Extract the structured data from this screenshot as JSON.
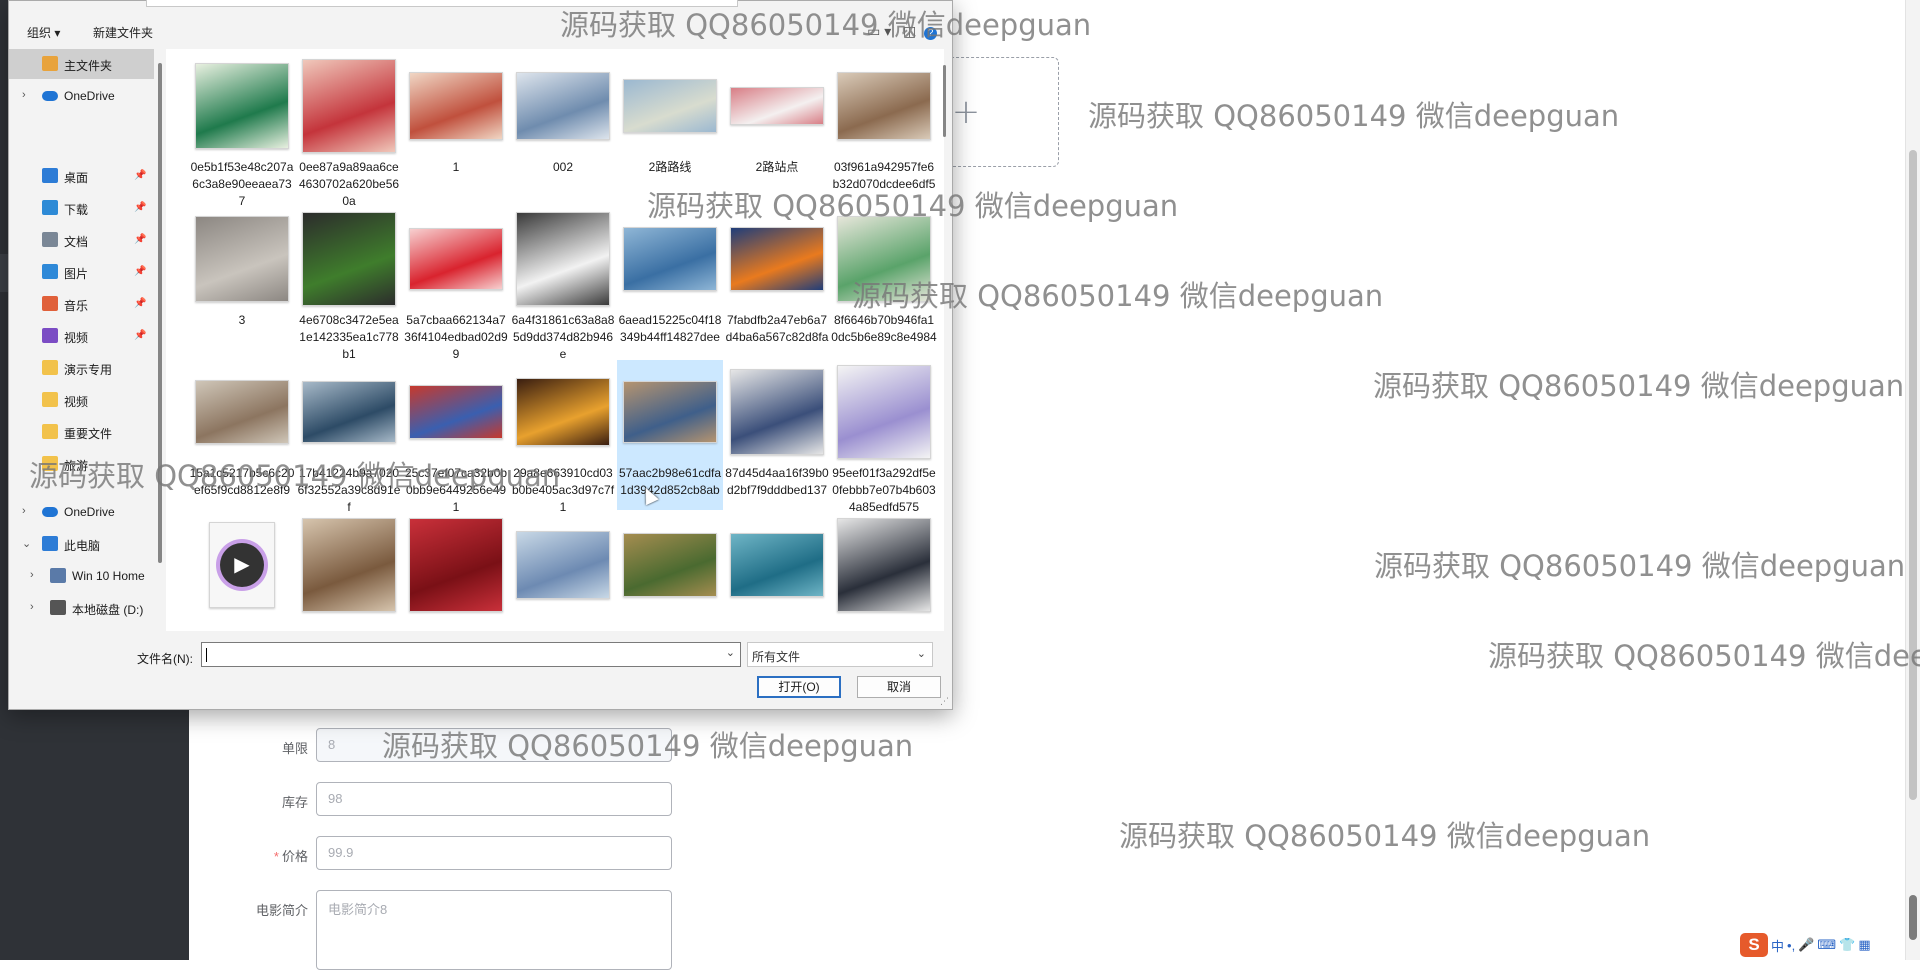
{
  "watermark": "源码获取 QQ86050149 微信deepguan",
  "dialog": {
    "toolbar": {
      "organize": "组织 ▾",
      "new_folder": "新建文件夹"
    },
    "nav": [
      {
        "label": "主文件夹",
        "icon": "home-icon",
        "color": "#e8a33c",
        "selected": true,
        "chevron": false,
        "pin": false
      },
      {
        "label": "OneDrive",
        "icon": "cloud-icon",
        "color": "#1f74d4",
        "selected": false,
        "chevron": true,
        "pin": false
      },
      {
        "label": "桌面",
        "icon": "desktop-icon",
        "color": "#2d7cd6",
        "selected": false,
        "chevron": false,
        "pin": true
      },
      {
        "label": "下载",
        "icon": "download-icon",
        "color": "#2d8ad6",
        "selected": false,
        "chevron": false,
        "pin": true
      },
      {
        "label": "文档",
        "icon": "document-icon",
        "color": "#7a8796",
        "selected": false,
        "chevron": false,
        "pin": true
      },
      {
        "label": "图片",
        "icon": "picture-icon",
        "color": "#2e89d8",
        "selected": false,
        "chevron": false,
        "pin": true
      },
      {
        "label": "音乐",
        "icon": "music-icon",
        "color": "#e0603a",
        "selected": false,
        "chevron": false,
        "pin": true
      },
      {
        "label": "视频",
        "icon": "video-icon",
        "color": "#7b4cc4",
        "selected": false,
        "chevron": false,
        "pin": true
      },
      {
        "label": "演示专用",
        "icon": "folder-icon",
        "color": "#f2c24b",
        "selected": false,
        "chevron": false,
        "pin": false
      },
      {
        "label": "视频",
        "icon": "folder-icon",
        "color": "#f2c24b",
        "selected": false,
        "chevron": false,
        "pin": false
      },
      {
        "label": "重要文件",
        "icon": "folder-icon",
        "color": "#f2c24b",
        "selected": false,
        "chevron": false,
        "pin": false
      },
      {
        "label": "旅游",
        "icon": "folder-icon",
        "color": "#f2c24b",
        "selected": false,
        "chevron": false,
        "pin": false
      },
      {
        "label": "OneDrive",
        "icon": "cloud-icon",
        "color": "#1f74d4",
        "selected": false,
        "chevron": true,
        "pin": false
      },
      {
        "label": "此电脑",
        "icon": "computer-icon",
        "color": "#2d7cd6",
        "selected": false,
        "chevron": true,
        "pin": false
      },
      {
        "label": "Win 10 Home",
        "icon": "drive-icon",
        "color": "#5a7aa8",
        "selected": false,
        "chevron": true,
        "pin": false
      },
      {
        "label": "本地磁盘 (D:)",
        "icon": "disk-icon",
        "color": "#555555",
        "selected": false,
        "chevron": true,
        "pin": false
      }
    ],
    "files": [
      {
        "name": "0e5b1f53e48c207a6c3a8e90eeaea737",
        "colors": [
          "#1f7a4c",
          "#e8f0e0"
        ]
      },
      {
        "name": "0ee87a9a89aa6ce4630702a620be560a",
        "colors": [
          "#c4343b",
          "#f0c8bb"
        ]
      },
      {
        "name": "1",
        "colors": [
          "#c0503d",
          "#f0d6c4"
        ]
      },
      {
        "name": "002",
        "colors": [
          "#6f8cae",
          "#dde4ec"
        ]
      },
      {
        "name": "2路路线",
        "colors": [
          "#d8dccf",
          "#9bb8d0"
        ]
      },
      {
        "name": "2路站点",
        "colors": [
          "#f4f0f0",
          "#d87e86"
        ]
      },
      {
        "name": "03f961a942957fe6b32d070dcdee6df5",
        "colors": [
          "#8b6a4f",
          "#d9cab8"
        ]
      },
      {
        "name": "3",
        "colors": [
          "#c9c4bd",
          "#8c8782"
        ]
      },
      {
        "name": "4e6708c3472e5ea1e142335ea1c778b1",
        "colors": [
          "#3f7d2c",
          "#2c2c2c"
        ]
      },
      {
        "name": "5a7cbaa662134a736f4104edbad02d99",
        "colors": [
          "#d9232e",
          "#f7d0d0"
        ]
      },
      {
        "name": "6a4f31861c63a8a85d9dd374d82b946e",
        "colors": [
          "#f2f2f2",
          "#3a3a3a"
        ]
      },
      {
        "name": "6aead15225c04f18349b44ff14827dee",
        "colors": [
          "#3a6fa3",
          "#8fb6d6"
        ]
      },
      {
        "name": "7fabdfb2a47eb6a7d4ba6a567c82d8fa",
        "colors": [
          "#e97a1e",
          "#1f3d7a"
        ]
      },
      {
        "name": "8f6646b70b946fa10dc5b6e89c8e4984",
        "colors": [
          "#5aa36a",
          "#e6e6da"
        ]
      },
      {
        "name": "15a1c5217b5c6c20ef65f9cd8812e8f9",
        "colors": [
          "#8c7560",
          "#cfc6b8"
        ]
      },
      {
        "name": "17b41224b9a70206f32552a39c8d91ef",
        "colors": [
          "#2d4b66",
          "#a7b9c8"
        ]
      },
      {
        "name": "25c37ef07ca32b0b0bb9e6449256e491",
        "colors": [
          "#3a5fb0",
          "#c7392d"
        ]
      },
      {
        "name": "29a8e663910cd03b0be405ac3d97c7f1",
        "colors": [
          "#e8a12e",
          "#3a1e10"
        ]
      },
      {
        "name": "57aac2b98e61cdfa1d3942d852cb8ab",
        "colors": [
          "#3f5f8a",
          "#b59470"
        ]
      },
      {
        "name": "87d45d4aa16f39b0d2bf7f9dddbed137",
        "colors": [
          "#3b4f7a",
          "#e6e6e6"
        ]
      },
      {
        "name": "95eef01f3a292df5e0febbb7e07b4b6034a85edfd575",
        "colors": [
          "#9a8fd0",
          "#f4f4f4"
        ]
      },
      {
        "name": "",
        "colors": [
          "#f8f8f8",
          "#4a4a4a"
        ]
      },
      {
        "name": "",
        "colors": [
          "#7a5a3e",
          "#d6c4ad"
        ]
      },
      {
        "name": "",
        "colors": [
          "#7a1016",
          "#c9303a"
        ]
      },
      {
        "name": "",
        "colors": [
          "#6d8ab2",
          "#c8d8e6"
        ]
      },
      {
        "name": "",
        "colors": [
          "#4a6a30",
          "#a58d50"
        ]
      },
      {
        "name": "",
        "colors": [
          "#1f6d86",
          "#6fb5c6"
        ]
      },
      {
        "name": "",
        "colors": [
          "#2a2f3a",
          "#e6e6e6"
        ]
      }
    ],
    "filename_label": "文件名(N):",
    "filetype": "所有文件",
    "open_button": "打开(O)",
    "cancel_button": "取消"
  },
  "form": {
    "rows": [
      {
        "label": "单限",
        "required": false,
        "value": "8",
        "disabled": true
      },
      {
        "label": "库存",
        "required": false,
        "value": "98",
        "disabled": false
      },
      {
        "label": "价格",
        "required": true,
        "value": "99.9",
        "disabled": false
      },
      {
        "label": "电影简介",
        "required": false,
        "value": "电影简介8",
        "disabled": false
      }
    ]
  },
  "tray": {
    "ime": "S",
    "items": [
      "中",
      "•,",
      "🎤",
      "⌨",
      "👕",
      "▦"
    ]
  }
}
